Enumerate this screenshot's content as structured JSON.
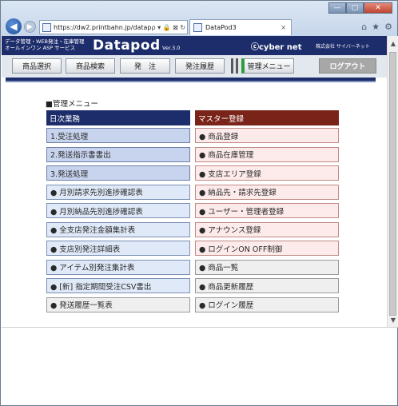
{
  "browser": {
    "address": "https://dw2.printbahn.jp/datap",
    "address_tools": "ρ ▾ 🔒 ⊠ ↻",
    "tab_title": "DataPod3",
    "tab_close": "×",
    "window_buttons": {
      "minimize": "—",
      "maximize": "▢",
      "close": "✕"
    },
    "right_icons": {
      "home": "⌂",
      "favorites": "★",
      "settings": "⚙"
    }
  },
  "site": {
    "tagline_line1": "データ管理・WEB発注・在庫管理",
    "tagline_line2": "オールインワン ASP サービス",
    "brand": "Datapod",
    "version": "Ver.3.0",
    "company_logo": "ⓒcyber net",
    "company_jp": "株式会社 サイバーネット"
  },
  "nav": {
    "items": [
      {
        "label": "商品選択"
      },
      {
        "label": "商品検索"
      },
      {
        "label": "発　注"
      },
      {
        "label": "発注履歴"
      },
      {
        "label": "管理メニュー"
      },
      {
        "label": "ログアウト"
      }
    ]
  },
  "content": {
    "section_label": "■管理メニュー",
    "left": {
      "header": "日次業務",
      "items": [
        {
          "label": "1.受注処理"
        },
        {
          "label": "2.発送指示書書出"
        },
        {
          "label": "3.発送処理"
        },
        {
          "label": "● 月別請求先別進捗確認表"
        },
        {
          "label": "● 月別納品先別進捗確認表"
        },
        {
          "label": "● 全支店発注金額集計表"
        },
        {
          "label": "● 支店別発注詳細表"
        },
        {
          "label": "● アイテム別発注集計表"
        },
        {
          "label": "● [新] 指定期間受注CSV書出"
        },
        {
          "label": "● 発送履歴一覧表"
        }
      ]
    },
    "right": {
      "header": "マスター登録",
      "items": [
        {
          "label": "● 商品登録"
        },
        {
          "label": "● 商品在庫管理"
        },
        {
          "label": "● 支店エリア登録"
        },
        {
          "label": "● 納品先・請求先登録"
        },
        {
          "label": "● ユーザー・管理者登録"
        },
        {
          "label": "● アナウンス登録"
        },
        {
          "label": "● ログインON OFF制御"
        },
        {
          "label": "● 商品一覧"
        },
        {
          "label": "● 商品更新履歴"
        },
        {
          "label": "● ログイン履歴"
        }
      ]
    }
  },
  "colors": {
    "header_navy": "#1d2d6b",
    "master_red": "#7a2318",
    "admin_green": "#2e9b3f"
  }
}
